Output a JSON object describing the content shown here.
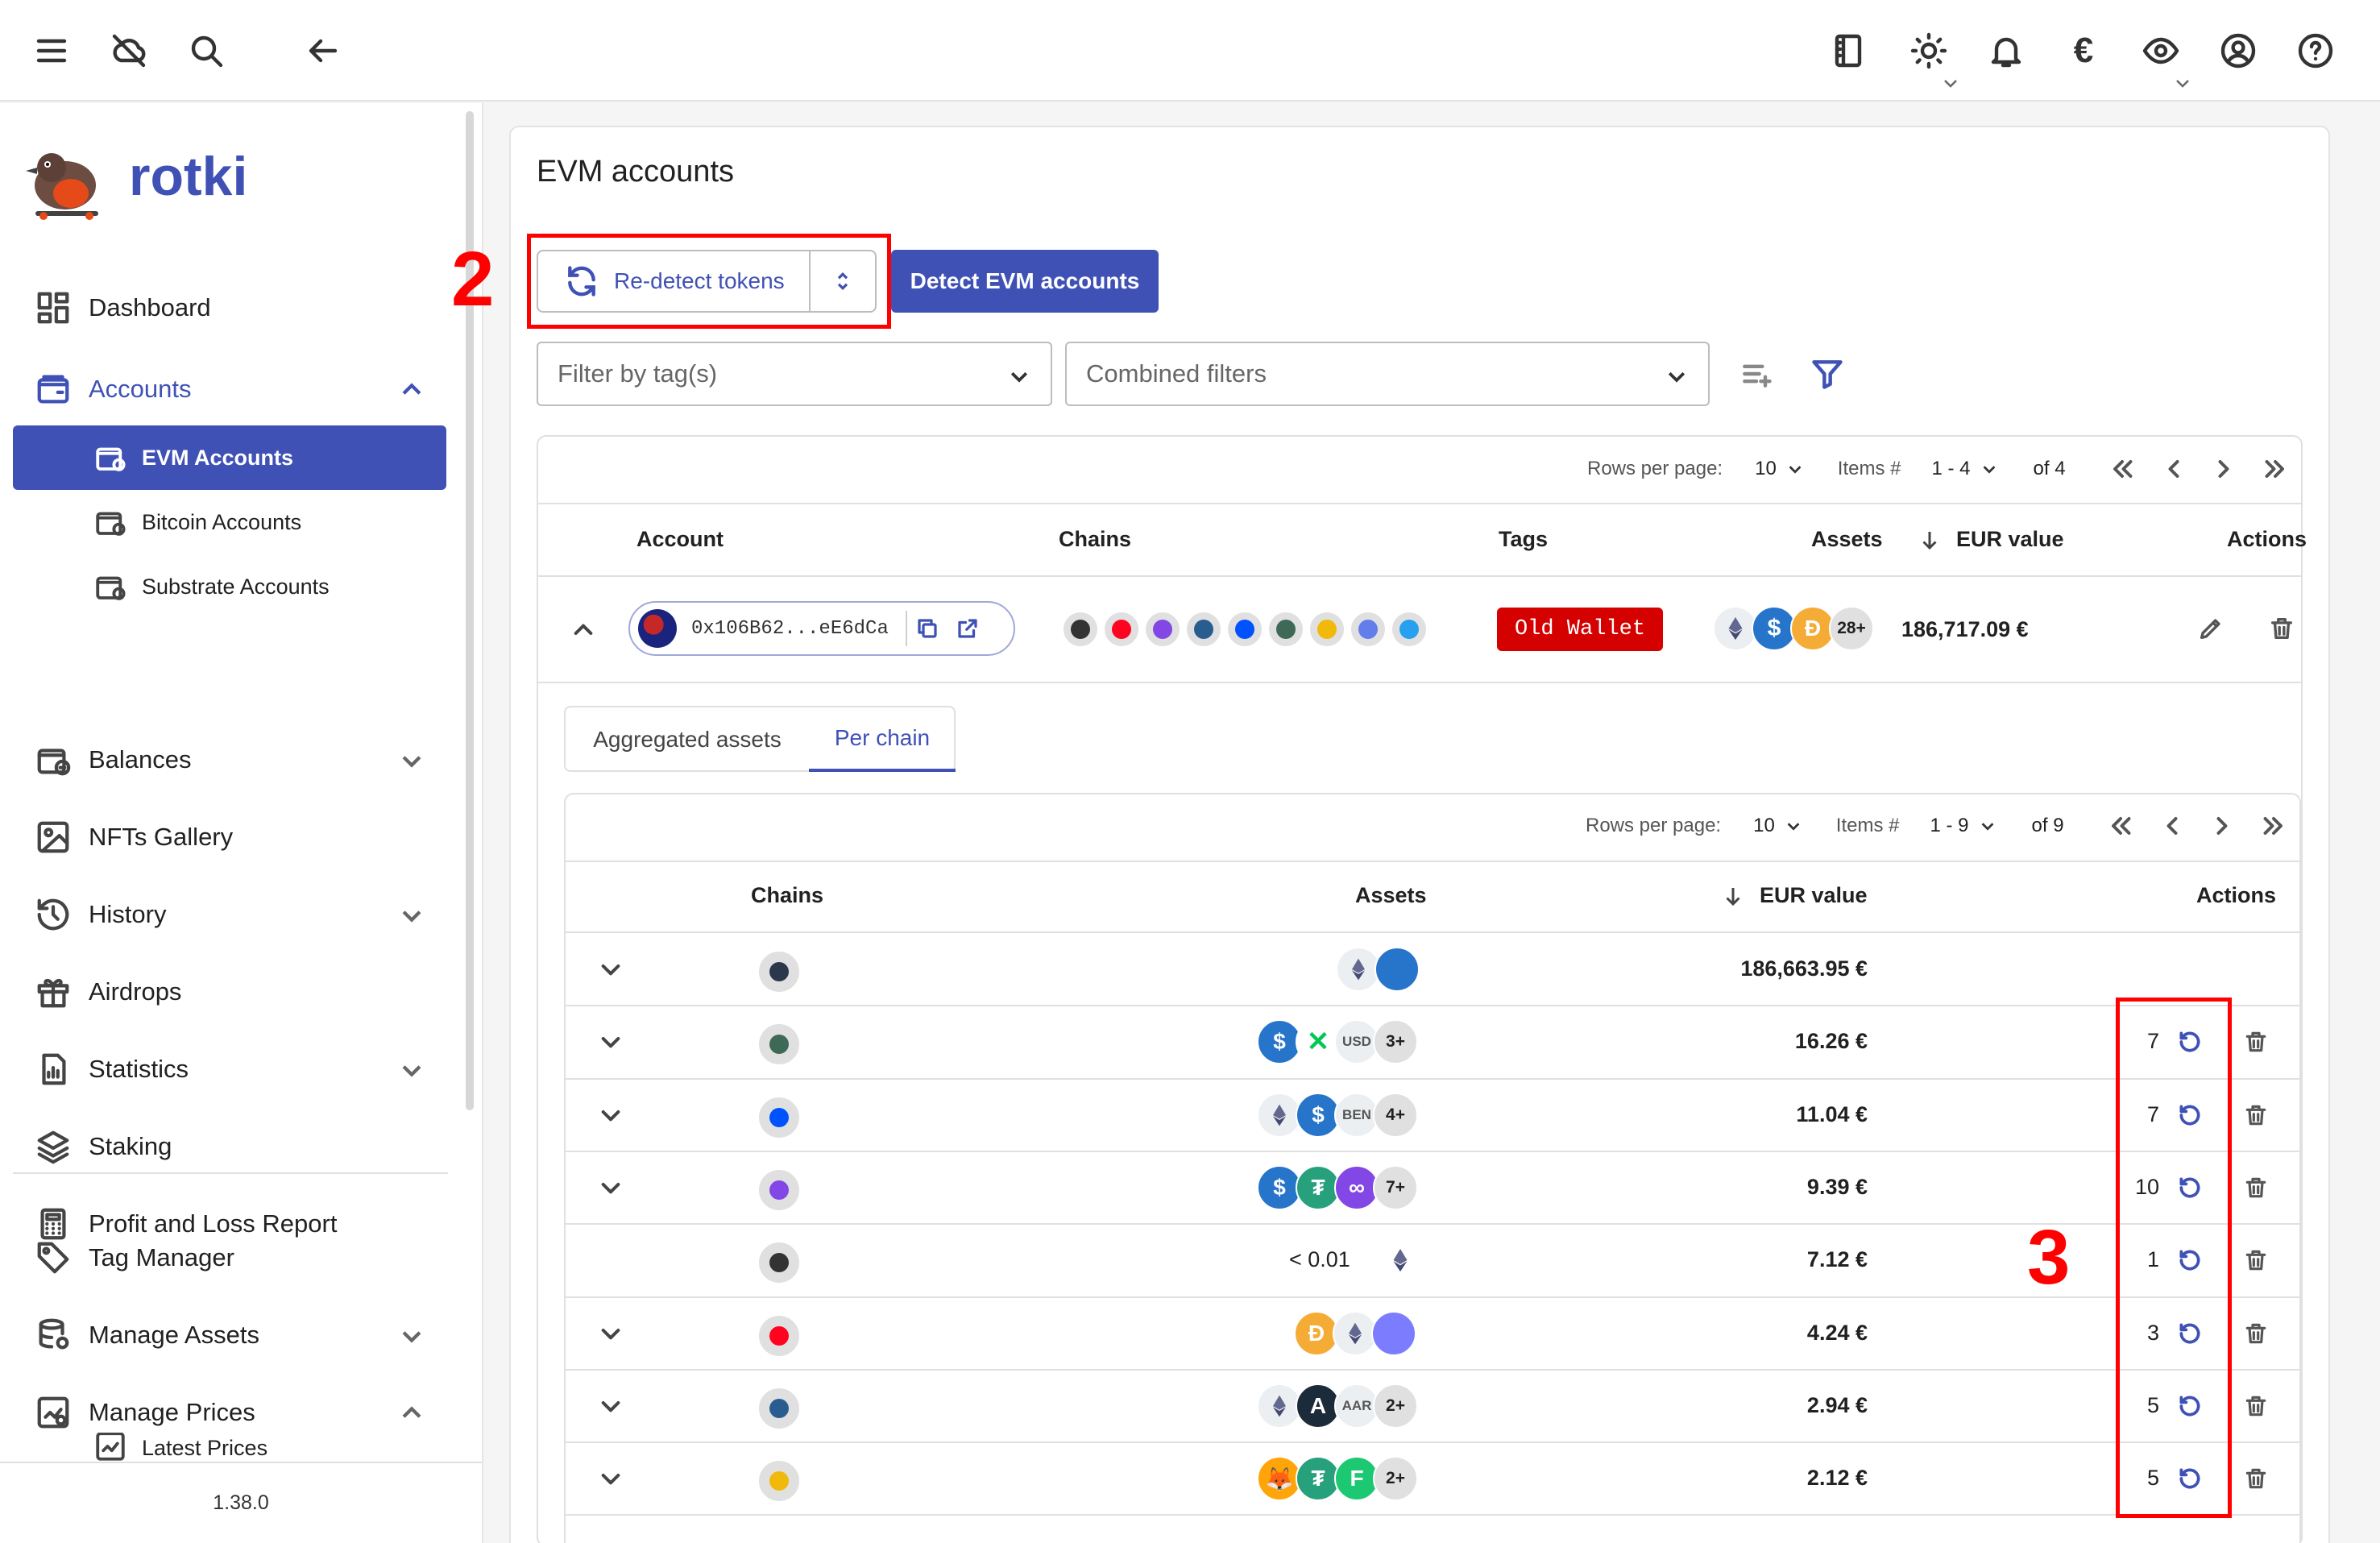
{
  "app": {
    "name": "rotki",
    "version": "1.38.0"
  },
  "colors": {
    "accent": "#3f51b5",
    "danger": "#d50000",
    "annotation": "#ff0000"
  },
  "topbar": {
    "left_icons": [
      "menu-icon",
      "cloud-off-icon",
      "search-icon",
      "back-arrow-icon"
    ],
    "right_icons": [
      "notes-icon",
      "theme-icon",
      "notifications-icon",
      "currency-icon",
      "privacy-eye-icon",
      "account-icon",
      "help-icon"
    ],
    "currency_symbol": "€"
  },
  "sidebar": {
    "items": [
      {
        "label": "Dashboard"
      },
      {
        "label": "Accounts"
      },
      {
        "label": "EVM Accounts"
      },
      {
        "label": "Bitcoin Accounts"
      },
      {
        "label": "Substrate Accounts"
      },
      {
        "label": "Balances"
      },
      {
        "label": "NFTs Gallery"
      },
      {
        "label": "History"
      },
      {
        "label": "Airdrops"
      },
      {
        "label": "Statistics"
      },
      {
        "label": "Staking"
      },
      {
        "label": "Profit and Loss Report"
      },
      {
        "label": "Tag Manager"
      },
      {
        "label": "Manage Assets"
      },
      {
        "label": "Manage Prices"
      },
      {
        "label": "Latest Prices"
      }
    ]
  },
  "main": {
    "title": "EVM accounts",
    "redetect_label": "Re-detect tokens",
    "detect_label": "Detect EVM accounts",
    "filter_tags_placeholder": "Filter by tag(s)",
    "combined_filters_placeholder": "Combined filters",
    "annotations": {
      "a2": "2",
      "a3": "3"
    }
  },
  "accounts_table": {
    "pager": {
      "rows_label": "Rows per page:",
      "rows_value": "10",
      "items_label": "Items #",
      "items_value": "1 - 4",
      "of_label": "of 4"
    },
    "columns": [
      "Account",
      "Chains",
      "Tags",
      "Assets",
      "EUR value",
      "Actions"
    ],
    "row": {
      "address": "0x106B62...eE6dCa",
      "tag": "Old Wallet",
      "more_assets": "28+",
      "value": "186,717.09 €"
    }
  },
  "tabs": [
    "Aggregated assets",
    "Per chain"
  ],
  "chains_table": {
    "pager": {
      "rows_label": "Rows per page:",
      "rows_value": "10",
      "items_label": "Items #",
      "items_value": "1 - 9",
      "of_label": "of 9"
    },
    "columns": [
      "Chains",
      "Assets",
      "EUR value",
      "Actions"
    ],
    "rows": [
      {
        "chain": "arbitrum",
        "value": "186,663.95 €",
        "count": "",
        "more": "",
        "chain_color": "#2d374b"
      },
      {
        "chain": "gnosis",
        "value": "16.26 €",
        "count": "7",
        "more": "3+",
        "chain_color": "#3e6957"
      },
      {
        "chain": "base",
        "value": "11.04 €",
        "count": "7",
        "more": "4+",
        "chain_color": "#0052ff"
      },
      {
        "chain": "polygon",
        "value": "9.39 €",
        "count": "10",
        "more": "7+",
        "chain_color": "#8247e5"
      },
      {
        "chain": "ethereum",
        "value": "7.12 €",
        "count": "1",
        "more": "",
        "prefix": "< 0.01",
        "chain_color": "#333333"
      },
      {
        "chain": "optimism",
        "value": "4.24 €",
        "count": "3",
        "more": "",
        "chain_color": "#ff0420"
      },
      {
        "chain": "scroll",
        "value": "2.94 €",
        "count": "5",
        "more": "2+",
        "chain_color": "#2a5d8f"
      },
      {
        "chain": "binance",
        "value": "2.12 €",
        "count": "5",
        "more": "2+",
        "chain_color": "#f0b90b"
      }
    ],
    "asset_labels": {
      "usd": "USD",
      "ben": "BEN",
      "aar": "AAR"
    }
  }
}
